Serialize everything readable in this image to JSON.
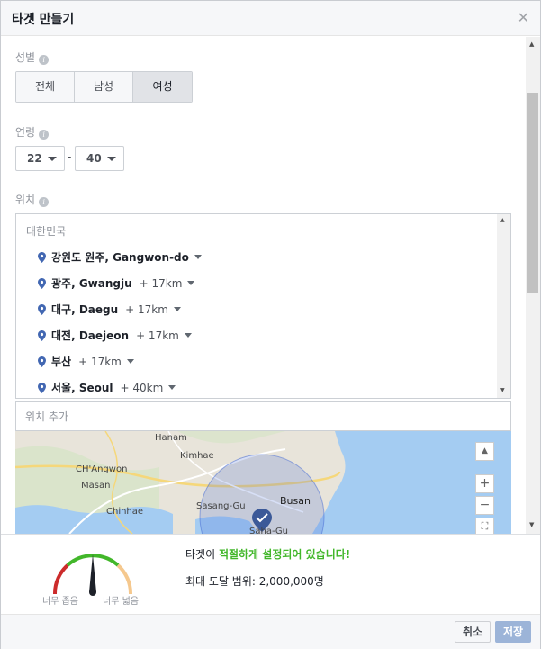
{
  "dialog": {
    "title": "타겟 만들기",
    "close_icon": "close-icon"
  },
  "gender": {
    "label": "성별",
    "options": [
      "전체",
      "남성",
      "여성"
    ],
    "selected": "여성"
  },
  "age": {
    "label": "연령",
    "min": "22",
    "separator": "-",
    "max": "40"
  },
  "location": {
    "label": "위치",
    "country": "대한민국",
    "items": [
      {
        "name": "강원도 원주, Gangwon-do",
        "radius": ""
      },
      {
        "name": "광주, Gwangju",
        "radius": "+ 17km"
      },
      {
        "name": "대구, Daegu",
        "radius": "+ 17km"
      },
      {
        "name": "대전, Daejeon",
        "radius": "+ 17km"
      },
      {
        "name": "부산",
        "radius": "+ 17km"
      },
      {
        "name": "서울, Seoul",
        "radius": "+ 40km"
      }
    ],
    "add_placeholder": "위치 추가"
  },
  "map": {
    "labels": [
      "Hanam",
      "Kimhae",
      "CH'Angwon",
      "Masan",
      "Chinhae",
      "Sasang-Gu",
      "Busan",
      "Saha-Gu"
    ],
    "zoom_in": "+",
    "zoom_out": "−",
    "water_color": "#a4ccf2",
    "circle_color": "#4a6fd6"
  },
  "audience": {
    "gauge_low_label": "너무 좁음",
    "gauge_high_label": "너무 넓음",
    "status_prefix": "타겟이 ",
    "status_highlight": "적절하게 설정되어 있습니다!",
    "reach": "최대 도달 범위: 2,000,000명"
  },
  "buttons": {
    "cancel": "취소",
    "save": "저장"
  },
  "colors": {
    "accent": "#4267b2",
    "good": "#42b72a",
    "save_disabled": "#9cb4d8"
  }
}
